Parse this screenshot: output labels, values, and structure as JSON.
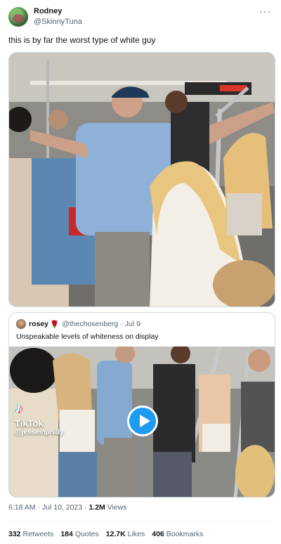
{
  "author": {
    "name": "Rodney",
    "handle": "@SkinnyTuna"
  },
  "more_icon": "ellipsis-icon",
  "tweet": {
    "text": "this is by far the worst type of white guy"
  },
  "quoted": {
    "name": "rosey",
    "emoji": "🌹",
    "handle": "@thechosenberg",
    "separator": "·",
    "date": "Jul 9",
    "text": "Unspeakable levels of whiteness on display",
    "watermark": {
      "logo": "♪",
      "brand": "TikTok",
      "user": "@jesseinphilly"
    },
    "play_icon": "play-icon"
  },
  "meta": {
    "time": "6:18 AM",
    "separator": "·",
    "date": "Jul 10, 2023",
    "views_count": "1.2M",
    "views_label": "Views"
  },
  "stats": {
    "retweets_count": "332",
    "retweets_label": "Retweets",
    "quotes_count": "184",
    "quotes_label": "Quotes",
    "likes_count": "12.7K",
    "likes_label": "Likes",
    "bookmarks_count": "406",
    "bookmarks_label": "Bookmarks"
  },
  "colors": {
    "accent": "#1d9bf0",
    "text": "#0f1419",
    "muted": "#536471"
  }
}
